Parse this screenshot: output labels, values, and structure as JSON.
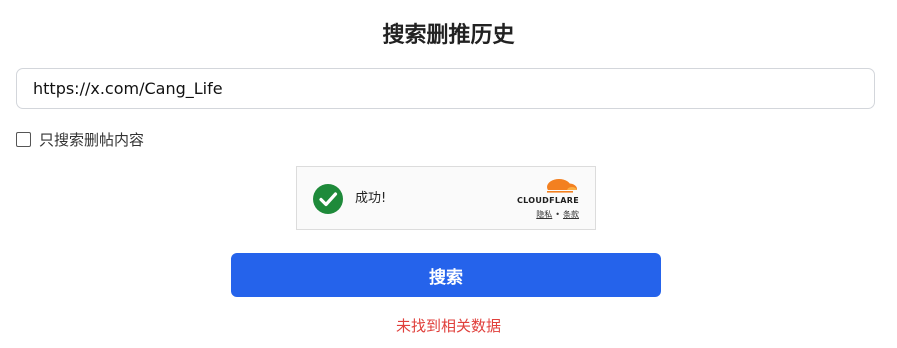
{
  "page": {
    "title": "搜索删推历史"
  },
  "search": {
    "value": "https://x.com/Cang_Life"
  },
  "filter": {
    "only_deleted_label": "只搜索删帖内容",
    "only_deleted_checked": false
  },
  "captcha": {
    "status": "成功!",
    "status_icon": "checkmark-icon",
    "brand": "CLOUDFLARE",
    "brand_icon": "cloud-icon",
    "privacy_link": "隐私",
    "separator": "•",
    "terms_link": "条款",
    "colors": {
      "success": "#1e8a3a",
      "brand_orange": "#f38020"
    }
  },
  "actions": {
    "search_button": "搜索",
    "button_color": "#2563eb"
  },
  "result": {
    "message": "未找到相关数据",
    "color": "#e0403c"
  }
}
